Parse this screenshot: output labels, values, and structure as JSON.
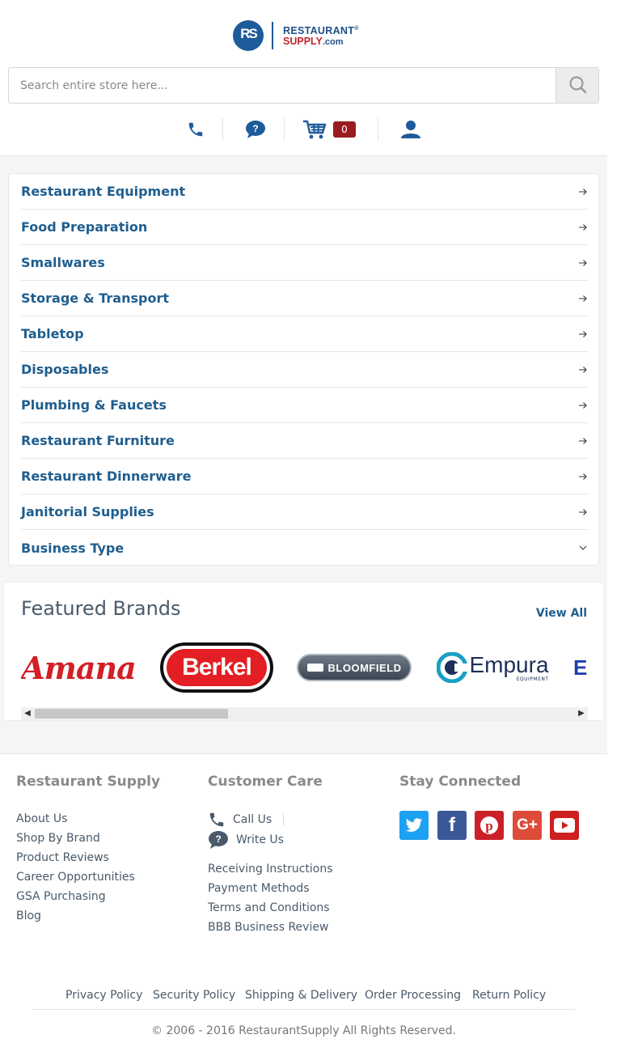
{
  "header": {
    "logo": {
      "initials": "RS",
      "line1": "RESTAURANT",
      "registered": "®",
      "line2": "SUPPLY",
      "line2_suffix": ".com"
    },
    "search": {
      "placeholder": "Search entire store here..."
    },
    "icons": {
      "phone": "phone-icon",
      "chat": "chat-question-icon",
      "cart": "cart-icon",
      "account": "user-icon"
    },
    "cart_count": "0"
  },
  "categories": [
    {
      "label": "Restaurant Equipment",
      "icon": "arrow-right-icon"
    },
    {
      "label": "Food Preparation",
      "icon": "arrow-right-icon"
    },
    {
      "label": "Smallwares",
      "icon": "arrow-right-icon"
    },
    {
      "label": "Storage & Transport",
      "icon": "arrow-right-icon"
    },
    {
      "label": "Tabletop",
      "icon": "arrow-right-icon"
    },
    {
      "label": "Disposables",
      "icon": "arrow-right-icon"
    },
    {
      "label": "Plumbing & Faucets",
      "icon": "arrow-right-icon"
    },
    {
      "label": "Restaurant Furniture",
      "icon": "arrow-right-icon"
    },
    {
      "label": "Restaurant Dinnerware",
      "icon": "arrow-right-icon"
    },
    {
      "label": "Janitorial Supplies",
      "icon": "arrow-right-icon"
    },
    {
      "label": "Business Type",
      "icon": "chevron-down-icon"
    }
  ],
  "featured": {
    "title": "Featured Brands",
    "view_all": "View All",
    "brands": [
      "Amana",
      "Berkel",
      "BLOOMFIELD",
      "Empura",
      "EQUIPMENT"
    ],
    "empura_sub": "EQUIPMENT"
  },
  "footer": {
    "col1": {
      "title": "Restaurant Supply",
      "links": [
        "About Us",
        "Shop By Brand",
        "Product Reviews",
        "Career Opportunities",
        "GSA Purchasing",
        "Blog"
      ]
    },
    "col2": {
      "title": "Customer Care",
      "call": "Call Us",
      "write": "Write Us",
      "links": [
        "Receiving Instructions",
        "Payment Methods",
        "Terms and Conditions",
        "BBB Business Review"
      ]
    },
    "col3": {
      "title": "Stay Connected",
      "social": [
        {
          "name": "twitter-icon",
          "color": "#1da1f2"
        },
        {
          "name": "facebook-icon",
          "color": "#3b5998"
        },
        {
          "name": "pinterest-icon",
          "color": "#cb2027"
        },
        {
          "name": "google-plus-icon",
          "color": "#dd4b39"
        },
        {
          "name": "youtube-icon",
          "color": "#cd201f"
        }
      ]
    },
    "policies": [
      "Privacy Policy",
      "Security Policy",
      "Shipping & Delivery",
      "Order Processing",
      "Return Policy"
    ],
    "copyright": "© 2006 - 2016 RestaurantSupply All Rights Reserved."
  },
  "colors": {
    "brand_blue": "#1e5b9a",
    "link_blue": "#1f5e8f",
    "cart_badge": "#9b1c1f"
  }
}
